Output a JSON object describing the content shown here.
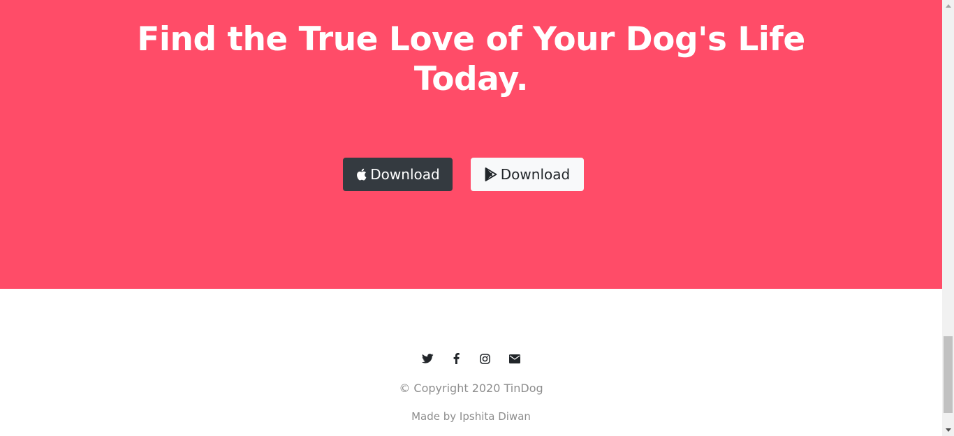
{
  "hero": {
    "title": "Find the True Love of Your Dog's Life Today.",
    "background_color": "#ff4c68",
    "apple_button": {
      "label": "Download",
      "icon": "apple-icon",
      "background_color": "#343a40"
    },
    "google_button": {
      "label": "Download",
      "icon": "google-play-icon",
      "background_color": "#f8f9fa"
    }
  },
  "footer": {
    "social_icons": [
      "twitter-icon",
      "facebook-icon",
      "instagram-icon",
      "envelope-icon"
    ],
    "copyright": "© Copyright 2020 TinDog",
    "made_by": "Made by Ipshita Diwan"
  }
}
